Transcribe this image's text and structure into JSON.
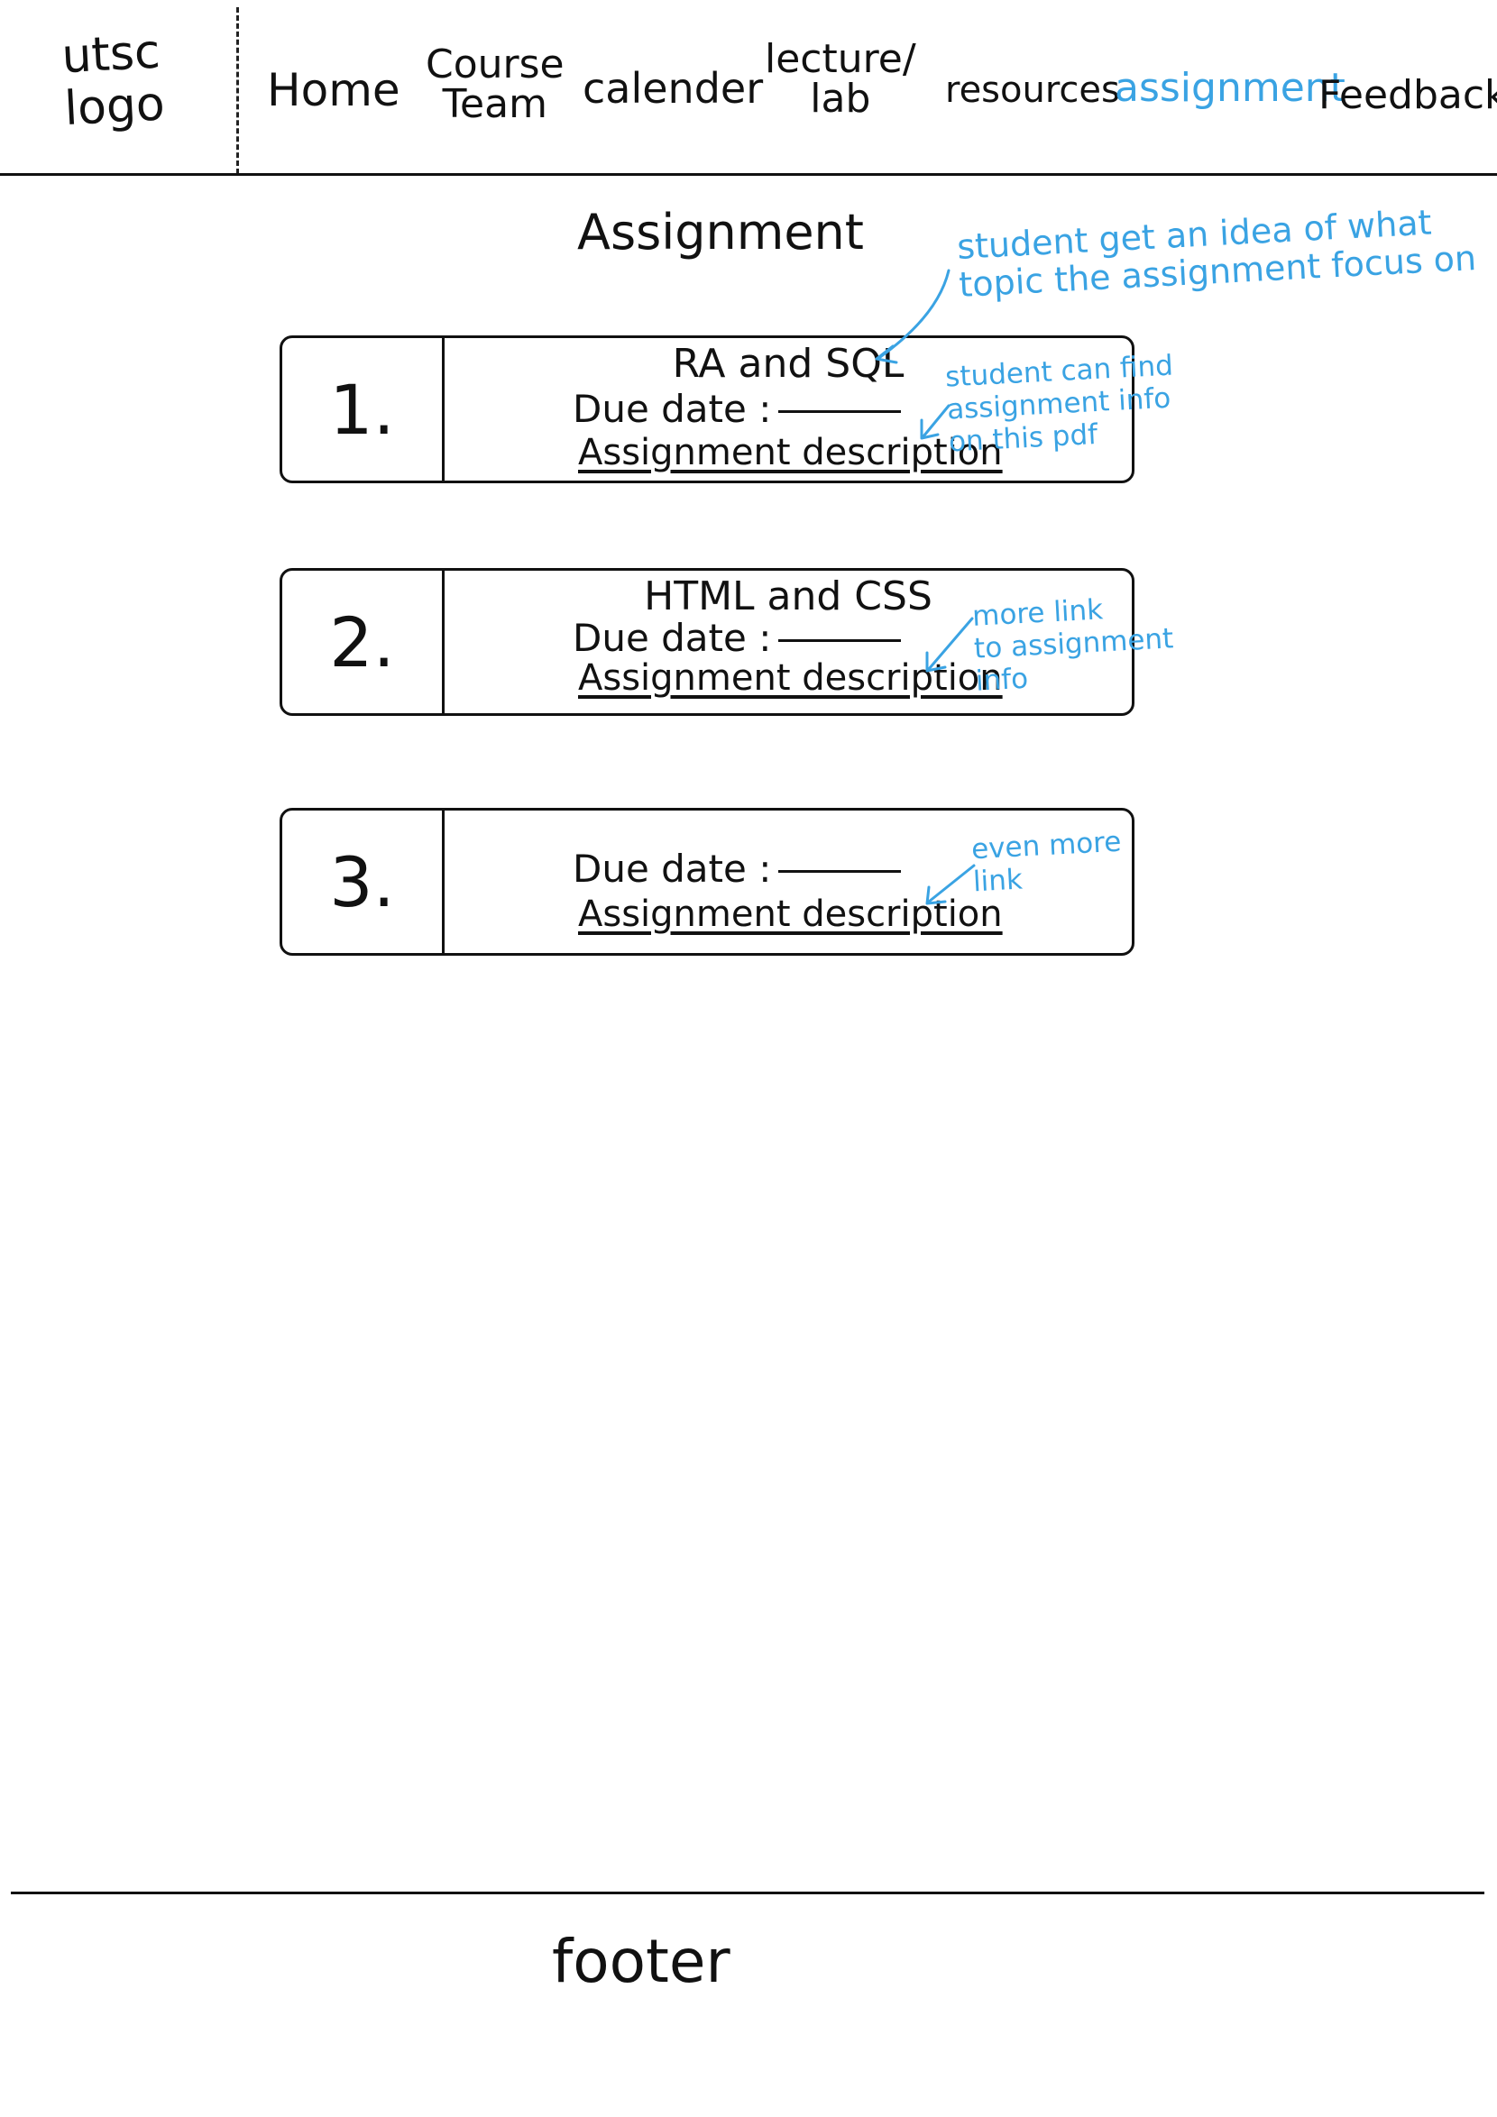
{
  "header": {
    "logo": "utsc\nlogo",
    "nav": [
      {
        "label": "Home"
      },
      {
        "label": "Course\nTeam"
      },
      {
        "label": "calender"
      },
      {
        "label": "lecture/\nlab"
      },
      {
        "label": "resources"
      },
      {
        "label": "assignment",
        "active": true
      },
      {
        "label": "Feedback"
      }
    ],
    "active_color": "#3aa3e3"
  },
  "main": {
    "title": "Assignment",
    "assignments": [
      {
        "number": "1.",
        "topic": "RA and SQL",
        "due_label": "Due date :",
        "link_label": "Assignment description"
      },
      {
        "number": "2.",
        "topic": "HTML and CSS",
        "due_label": "Due date :",
        "link_label": "Assignment description"
      },
      {
        "number": "3.",
        "topic": "",
        "due_label": "Due date :",
        "link_label": "Assignment description"
      }
    ]
  },
  "annotations": [
    {
      "text": "student get an idea of what\ntopic the assignment focus on"
    },
    {
      "text": "student can find\nassignment info\non this pdf"
    },
    {
      "text": "more link\nto assignment\ninfo"
    },
    {
      "text": "even more\nlink"
    }
  ],
  "footer": {
    "label": "footer"
  },
  "colors": {
    "annotation": "#3aa3e3",
    "ink": "#111111"
  }
}
